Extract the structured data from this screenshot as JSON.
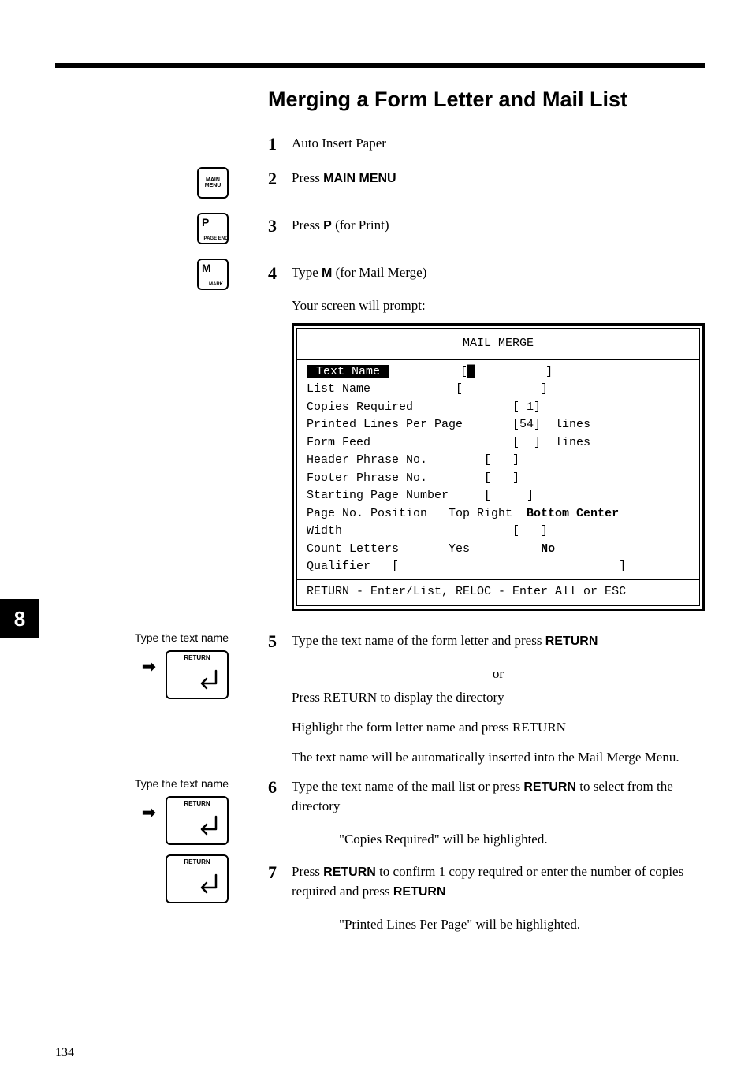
{
  "title": "Merging a Form Letter and Mail List",
  "side_tab": "8",
  "page_number": "134",
  "keys": {
    "main_menu": "MAIN\nMENU",
    "p": "P",
    "p_sub": "PAGE END",
    "m": "M",
    "m_sub": "MARK",
    "return": "RETURN"
  },
  "margins": {
    "type_text_name": "Type the text name"
  },
  "steps": {
    "s1": {
      "num": "1",
      "text": "Auto Insert Paper"
    },
    "s2": {
      "num": "2",
      "pre": "Press ",
      "bold": "MAIN MENU"
    },
    "s3": {
      "num": "3",
      "pre": "Press ",
      "bold": "P",
      "post": " (for Print)"
    },
    "s4": {
      "num": "4",
      "pre": "Type ",
      "bold": "M",
      "post": " (for Mail Merge)"
    },
    "prompt": "Your screen will prompt:",
    "s5": {
      "num": "5",
      "line1_pre": "Type the text name of the form letter and press ",
      "line1_bold": "RETURN",
      "or": "or",
      "line2_pre": "Press ",
      "line2_bold": "RETURN",
      "line2_post": " to display the directory",
      "line3_pre": "Highlight the form letter name and press ",
      "line3_bold": "RETURN",
      "line4": "The text name will be automatically inserted into the Mail Merge Menu."
    },
    "s6": {
      "num": "6",
      "pre": "Type the text name of the mail list or press ",
      "bold": "RETURN",
      "post": " to select from the directory",
      "hl": "\"Copies Required\" will be highlighted."
    },
    "s7": {
      "num": "7",
      "pre": "Press ",
      "bold": "RETURN",
      "mid": " to confirm 1 copy required or enter the number of copies required and press ",
      "bold2": "RETURN",
      "hl": "\"Printed Lines Per Page\" will be highlighted."
    }
  },
  "screen": {
    "title": "MAIL MERGE",
    "rows": {
      "text_name_lbl": " Text Name ",
      "text_name_val": "[█          ]",
      "list_name": "List Name            [           ]",
      "copies": "Copies Required              [ 1]",
      "plpp": "Printed Lines Per Page       [54]  lines",
      "ff": "Form Feed                    [  ]  lines",
      "header": "Header Phrase No.        [   ]",
      "footer": "Footer Phrase No.        [   ]",
      "spn": "Starting Page Number     [     ]",
      "pnp_lbl": "Page No. Position   Top Right  ",
      "pnp_bold": "Bottom Center",
      "width": "Width                        [   ]",
      "count_lbl": "Count Letters       Yes          ",
      "count_bold": "No",
      "qualifier": "Qualifier   [                               ]"
    },
    "footer": "RETURN - Enter/List, RELOC - Enter All or ESC"
  }
}
